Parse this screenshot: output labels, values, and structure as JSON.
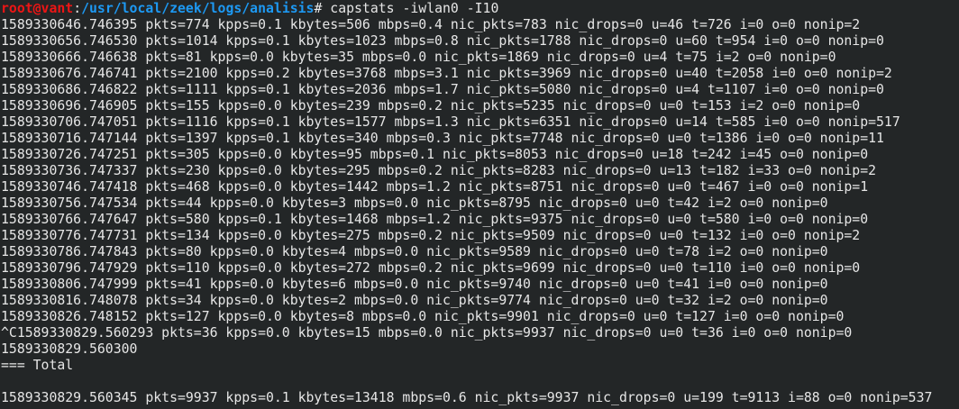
{
  "prompt": {
    "user_host": "root@vant",
    "separator": ":",
    "cwd": "/usr/local/zeek/logs/analisis",
    "symbol": "#",
    "command": " capstats -iwlan0 -I10"
  },
  "colors": {
    "background": "#232627",
    "user": "#ed1515",
    "path": "#1d99f3",
    "text": "#e6e6e6"
  },
  "output": {
    "lines": [
      "1589330646.746395 pkts=774 kpps=0.1 kbytes=506 mbps=0.4 nic_pkts=783 nic_drops=0 u=46 t=726 i=0 o=0 nonip=2",
      "1589330656.746530 pkts=1014 kpps=0.1 kbytes=1023 mbps=0.8 nic_pkts=1788 nic_drops=0 u=60 t=954 i=0 o=0 nonip=0",
      "1589330666.746638 pkts=81 kpps=0.0 kbytes=35 mbps=0.0 nic_pkts=1869 nic_drops=0 u=4 t=75 i=2 o=0 nonip=0",
      "1589330676.746741 pkts=2100 kpps=0.2 kbytes=3768 mbps=3.1 nic_pkts=3969 nic_drops=0 u=40 t=2058 i=0 o=0 nonip=2",
      "1589330686.746822 pkts=1111 kpps=0.1 kbytes=2036 mbps=1.7 nic_pkts=5080 nic_drops=0 u=4 t=1107 i=0 o=0 nonip=0",
      "1589330696.746905 pkts=155 kpps=0.0 kbytes=239 mbps=0.2 nic_pkts=5235 nic_drops=0 u=0 t=153 i=2 o=0 nonip=0",
      "1589330706.747051 pkts=1116 kpps=0.1 kbytes=1577 mbps=1.3 nic_pkts=6351 nic_drops=0 u=14 t=585 i=0 o=0 nonip=517",
      "1589330716.747144 pkts=1397 kpps=0.1 kbytes=340 mbps=0.3 nic_pkts=7748 nic_drops=0 u=0 t=1386 i=0 o=0 nonip=11",
      "1589330726.747251 pkts=305 kpps=0.0 kbytes=95 mbps=0.1 nic_pkts=8053 nic_drops=0 u=18 t=242 i=45 o=0 nonip=0",
      "1589330736.747337 pkts=230 kpps=0.0 kbytes=295 mbps=0.2 nic_pkts=8283 nic_drops=0 u=13 t=182 i=33 o=0 nonip=2",
      "1589330746.747418 pkts=468 kpps=0.0 kbytes=1442 mbps=1.2 nic_pkts=8751 nic_drops=0 u=0 t=467 i=0 o=0 nonip=1",
      "1589330756.747534 pkts=44 kpps=0.0 kbytes=3 mbps=0.0 nic_pkts=8795 nic_drops=0 u=0 t=42 i=2 o=0 nonip=0",
      "1589330766.747647 pkts=580 kpps=0.1 kbytes=1468 mbps=1.2 nic_pkts=9375 nic_drops=0 u=0 t=580 i=0 o=0 nonip=0",
      "1589330776.747731 pkts=134 kpps=0.0 kbytes=275 mbps=0.2 nic_pkts=9509 nic_drops=0 u=0 t=132 i=0 o=0 nonip=2",
      "1589330786.747843 pkts=80 kpps=0.0 kbytes=4 mbps=0.0 nic_pkts=9589 nic_drops=0 u=0 t=78 i=2 o=0 nonip=0",
      "1589330796.747929 pkts=110 kpps=0.0 kbytes=272 mbps=0.2 nic_pkts=9699 nic_drops=0 u=0 t=110 i=0 o=0 nonip=0",
      "1589330806.747999 pkts=41 kpps=0.0 kbytes=6 mbps=0.0 nic_pkts=9740 nic_drops=0 u=0 t=41 i=0 o=0 nonip=0",
      "1589330816.748078 pkts=34 kpps=0.0 kbytes=2 mbps=0.0 nic_pkts=9774 nic_drops=0 u=0 t=32 i=2 o=0 nonip=0",
      "1589330826.748152 pkts=127 kpps=0.0 kbytes=8 mbps=0.0 nic_pkts=9901 nic_drops=0 u=0 t=127 i=0 o=0 nonip=0",
      "^C1589330829.560293 pkts=36 kpps=0.0 kbytes=15 mbps=0.0 nic_pkts=9937 nic_drops=0 u=0 t=36 i=0 o=0 nonip=0",
      "1589330829.560300",
      "=== Total",
      "",
      "1589330829.560345 pkts=9937 kpps=0.1 kbytes=13418 mbps=0.6 nic_pkts=9937 nic_drops=0 u=199 t=9113 i=88 o=0 nonip=537"
    ]
  }
}
